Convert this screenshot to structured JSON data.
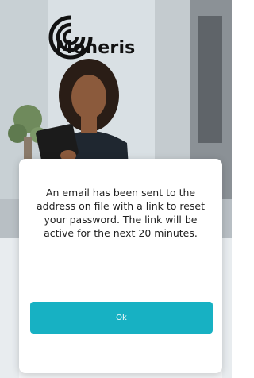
{
  "brand": {
    "name": "Moneris",
    "accent": "#17b1c3"
  },
  "dialog": {
    "message": "An email has been sent to the address on file with a link to reset your password. The link will be active for the next 20 minutes.",
    "ok_label": "Ok"
  }
}
